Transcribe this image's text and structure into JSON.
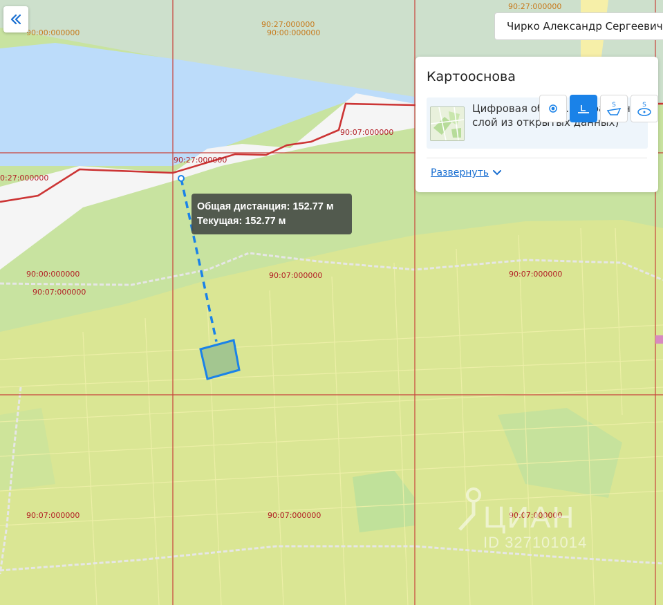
{
  "colors": {
    "water": "#bcdcfa",
    "beach": "#f5f5f5",
    "land": "#c8e3a0",
    "parcel": "#dde692",
    "grid_line": "#c8423a",
    "boundary": "#cc3535",
    "measure": "#1a82e8"
  },
  "icons": {
    "collapse": "double-chevron-left-icon",
    "expand": "chevron-down-icon"
  },
  "owner": {
    "name": "Чирко Александр Сергеевич"
  },
  "panel": {
    "title": "Картооснова",
    "layer_text": "Цифровая об... с... (справочный слой из открытых данных)",
    "expand_label": "Развернуть"
  },
  "tools": [
    {
      "name": "point-tool",
      "icon": "point-icon",
      "active": false
    },
    {
      "name": "ruler-tool",
      "icon": "ruler-icon",
      "active": true
    },
    {
      "name": "area-polygon-tool",
      "icon": "area-polygon-icon",
      "active": false
    },
    {
      "name": "area-circle-tool",
      "icon": "area-circle-icon",
      "active": false
    }
  ],
  "measurement": {
    "total": "Общая дистанция: 152.77 м",
    "current": "Текущая: 152.77 м"
  },
  "grid_labels": [
    {
      "text": "90:00:000000",
      "color": "orange"
    },
    {
      "text": "90:27:000000",
      "color": "orange"
    },
    {
      "text": "90:00:000000",
      "color": "orange"
    },
    {
      "text": "90:27:000000",
      "color": "orange"
    },
    {
      "text": "90:07:000000",
      "color": "red"
    },
    {
      "text": "90:27:000000",
      "color": "red"
    },
    {
      "text": "0:27:000000",
      "color": "red"
    },
    {
      "text": "90:00:000000",
      "color": "red"
    },
    {
      "text": "90:07:000000",
      "color": "red"
    },
    {
      "text": "90:07:000000",
      "color": "red"
    },
    {
      "text": "90:07:000000",
      "color": "red"
    },
    {
      "text": "90:07:000000",
      "color": "red"
    },
    {
      "text": "90:07:000000",
      "color": "red"
    },
    {
      "text": "90:07:000000",
      "color": "red"
    }
  ],
  "watermark": {
    "word": "ЦИАН",
    "id": "ID 327101014"
  }
}
